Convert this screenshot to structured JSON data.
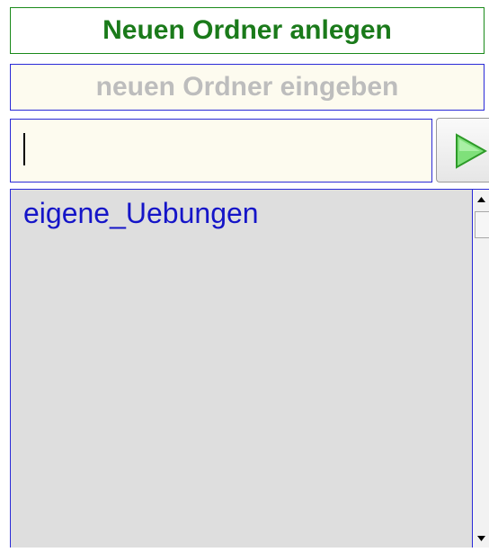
{
  "header": {
    "title": "Neuen Ordner anlegen"
  },
  "hint": {
    "text": "neuen Ordner eingeben"
  },
  "folder_input": {
    "value": "",
    "submit_icon": "play-triangle-icon",
    "icon_color": "#34b52d"
  },
  "folder_list": {
    "items": [
      {
        "label": "eigene_Uebungen"
      }
    ]
  },
  "colors": {
    "title_text": "#1a7a1a",
    "border_blue": "#2a2ad8",
    "hint_text": "#bdbdbd",
    "list_background": "#dedede",
    "list_text": "#1515c8"
  }
}
